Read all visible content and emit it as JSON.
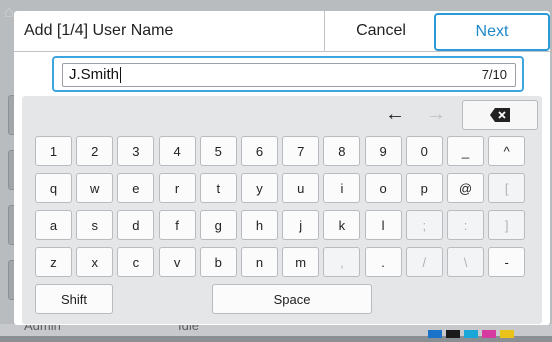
{
  "backdrop": {
    "status_left": "Admin",
    "status_mid": "Idle",
    "toner_colors": [
      "#1a73c9",
      "#1b1b1b",
      "#1aa6d8",
      "#d63aa0",
      "#e9c21a"
    ]
  },
  "dialog": {
    "title": "Add [1/4] User Name",
    "cancel_label": "Cancel",
    "next_label": "Next"
  },
  "input": {
    "value": "J.Smith",
    "counter": "7/10"
  },
  "keyboard": {
    "nav": {
      "left": "left-arrow-icon",
      "right": "right-arrow-icon",
      "backspace": "backspace-icon"
    },
    "rows": [
      [
        "1",
        "2",
        "3",
        "4",
        "5",
        "6",
        "7",
        "8",
        "9",
        "0",
        "_",
        "^"
      ],
      [
        "q",
        "w",
        "e",
        "r",
        "t",
        "y",
        "u",
        "i",
        "o",
        "p",
        "@",
        "["
      ],
      [
        "a",
        "s",
        "d",
        "f",
        "g",
        "h",
        "j",
        "k",
        "l",
        ";",
        ":",
        "]"
      ],
      [
        "z",
        "x",
        "c",
        "v",
        "b",
        "n",
        "m",
        ",",
        ".",
        "/",
        "\\",
        "-"
      ]
    ],
    "disabled": [
      "[",
      ";",
      ":",
      "]",
      ",",
      "/",
      "\\"
    ],
    "shift_label": "Shift",
    "space_label": "Space"
  }
}
